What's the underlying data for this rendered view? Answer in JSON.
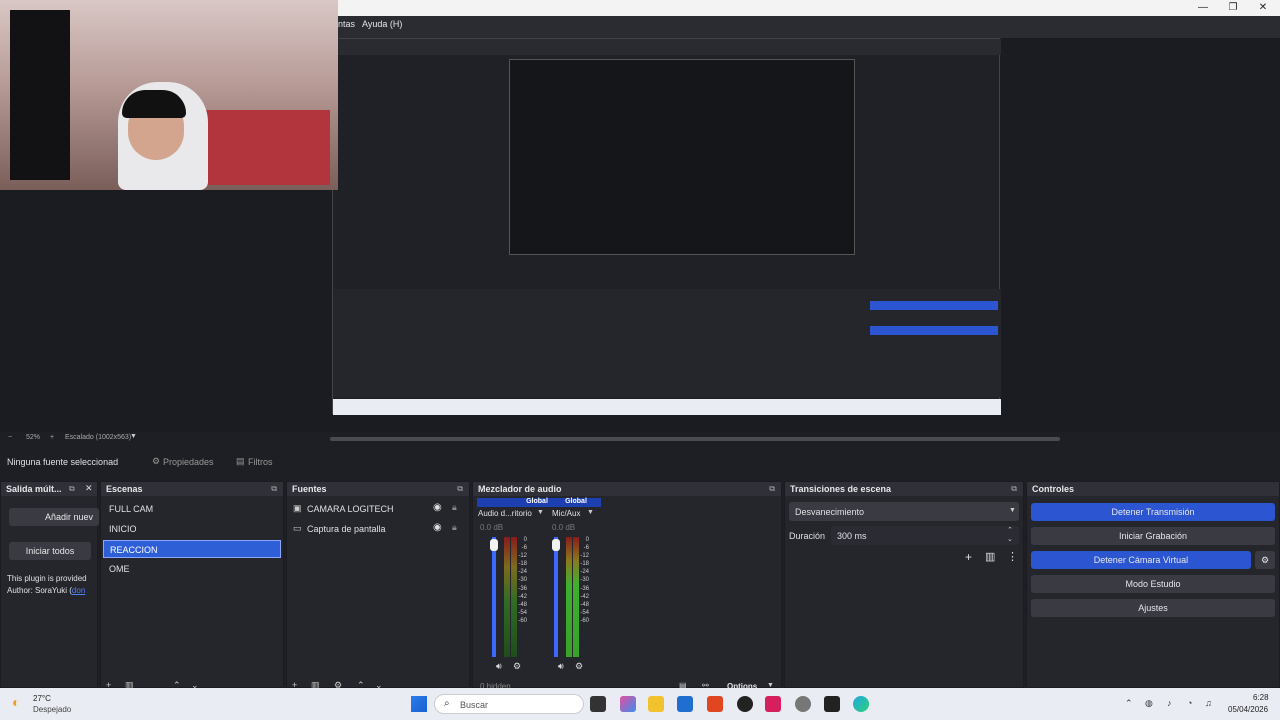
{
  "menubar": {
    "items": [
      "ntas",
      "Ayuda (H)"
    ]
  },
  "preview": {
    "zoom": "52%",
    "scale": "Escalado (1002x563)"
  },
  "status": {
    "selected_source": "Ninguna fuente seleccionad",
    "properties": "Propiedades",
    "filters": "Filtros"
  },
  "docks": {
    "salida": {
      "title": "Salida múlt...",
      "add": "Añadir nuev",
      "start_all": "Iniciar todos",
      "plugin_line1": "This plugin is provided",
      "plugin_line2": "Author: SoraYuki (",
      "plugin_link": "don"
    },
    "escenas": {
      "title": "Escenas",
      "items": [
        "FULL CAM",
        "INICIO",
        "REACCION",
        "OME"
      ],
      "selected": 2
    },
    "fuentes": {
      "title": "Fuentes",
      "items": [
        "CAMARA LOGITECH",
        "Captura de pantalla"
      ]
    },
    "mezclador": {
      "title": "Mezclador de audio",
      "ch1": {
        "tag": "Global",
        "name": "Audio d...ritorio",
        "level": "0.0 dB"
      },
      "ch2": {
        "tag": "Global",
        "name": "Mic/Aux",
        "level": "0.0 dB"
      },
      "ticks": [
        "0",
        "-6",
        "-12",
        "-18",
        "-24",
        "-30",
        "-36",
        "-42",
        "-48",
        "-54",
        "-60"
      ],
      "hidden": "0 hidden",
      "options": "Options"
    },
    "transiciones": {
      "title": "Transiciones de escena",
      "transition": "Desvanecimiento",
      "duration_label": "Duración",
      "duration_value": "300 ms"
    },
    "controles": {
      "title": "Controles",
      "stop_stream": "Detener Transmisión",
      "start_rec": "Iniciar Grabación",
      "stop_vcam": "Detener Cámara Virtual",
      "studio": "Modo Estudio",
      "settings": "Ajustes"
    }
  },
  "taskbar": {
    "weather_temp": "27°C",
    "weather_desc": "Despejado",
    "search": "Buscar",
    "time": "6:28",
    "date": "05/04/2026"
  },
  "colors": {
    "accent": "#2c55d1",
    "selected": "#2f5fd6"
  }
}
